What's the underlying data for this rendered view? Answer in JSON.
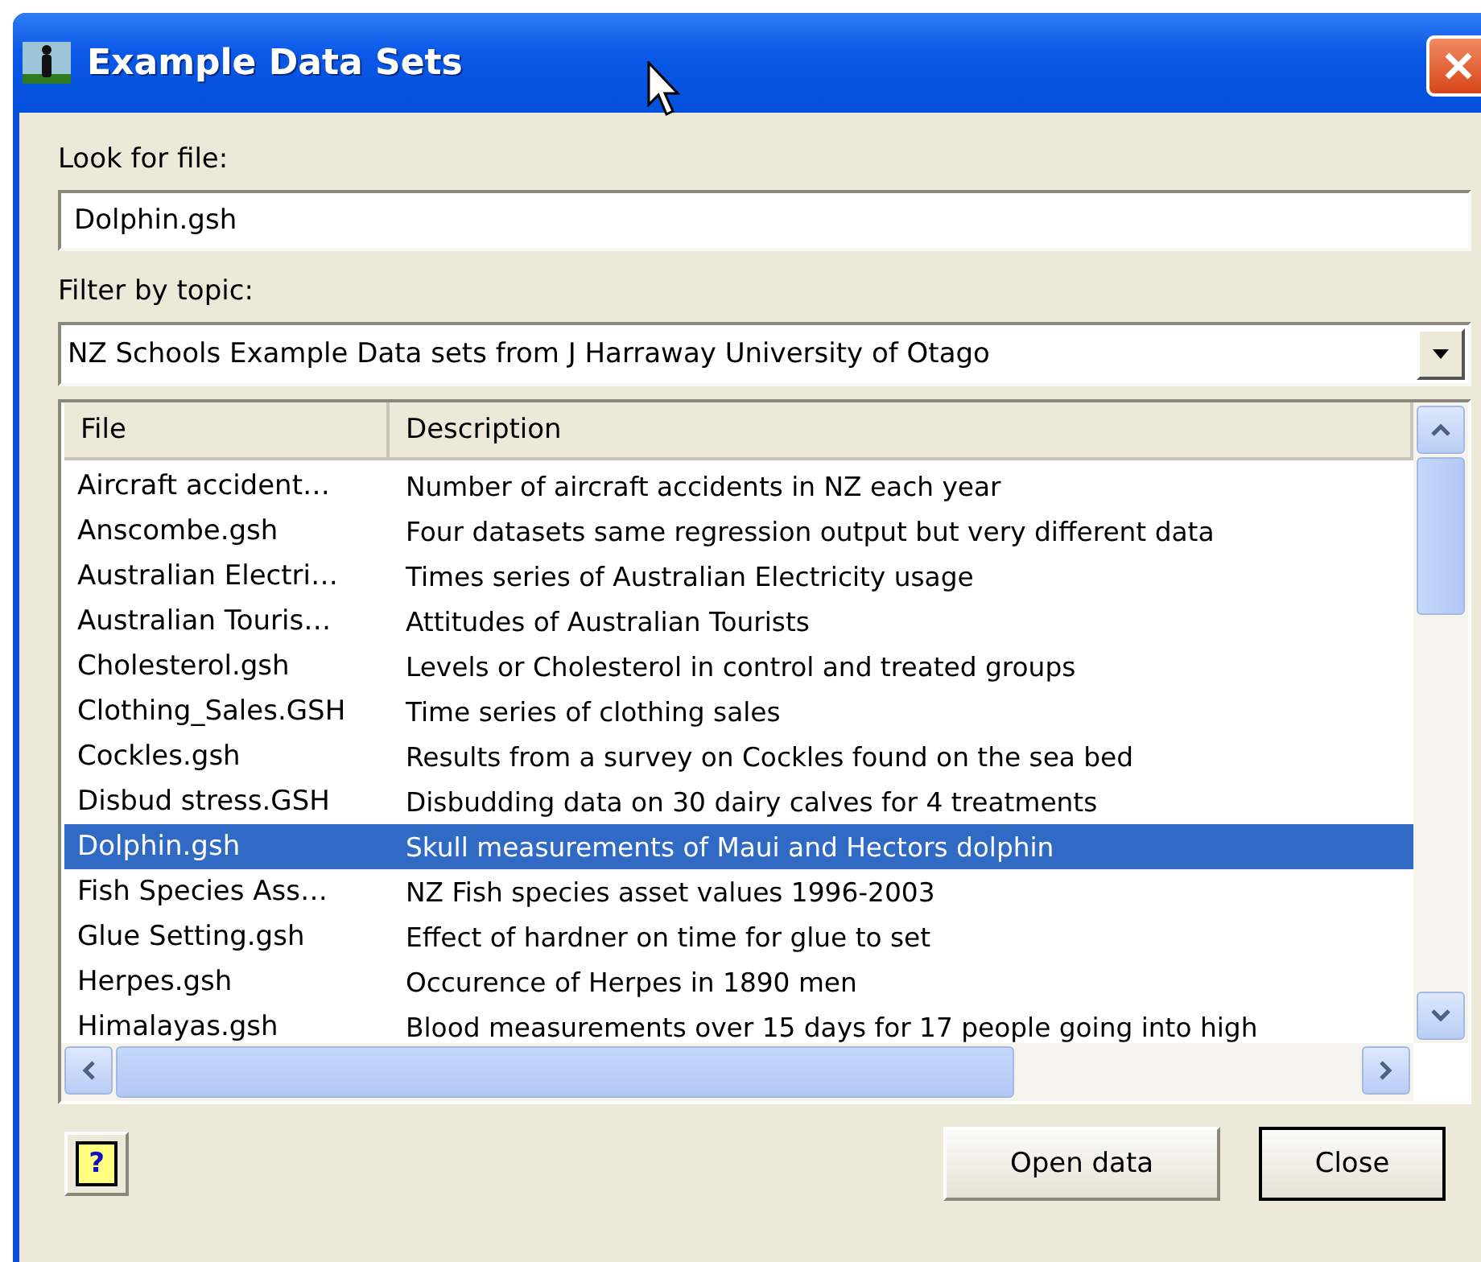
{
  "window": {
    "title": "Example Data Sets"
  },
  "look_for_file": {
    "label": "Look for file:",
    "value": "Dolphin.gsh"
  },
  "filter": {
    "label": "Filter by topic:",
    "value": "NZ Schools Example Data sets from J Harraway University of Otago"
  },
  "table": {
    "columns": [
      "File",
      "Description"
    ],
    "rows": [
      {
        "file": "Aircraft accident…",
        "description": "Number of aircraft accidents in NZ each year",
        "selected": false
      },
      {
        "file": "Anscombe.gsh",
        "description": "Four datasets same regression output but very different data",
        "selected": false
      },
      {
        "file": "Australian Electri…",
        "description": "Times series of Australian Electricity usage",
        "selected": false
      },
      {
        "file": "Australian Touris…",
        "description": "Attitudes of Australian Tourists",
        "selected": false
      },
      {
        "file": "Cholesterol.gsh",
        "description": "Levels or Cholesterol in control and treated groups",
        "selected": false
      },
      {
        "file": "Clothing_Sales.GSH",
        "description": "Time series of clothing sales",
        "selected": false
      },
      {
        "file": "Cockles.gsh",
        "description": "Results from a survey on Cockles found on the sea bed",
        "selected": false
      },
      {
        "file": "Disbud stress.GSH",
        "description": "Disbudding data on 30 dairy calves for 4 treatments",
        "selected": false
      },
      {
        "file": "Dolphin.gsh",
        "description": "Skull measurements of Maui and Hectors dolphin",
        "selected": true
      },
      {
        "file": "Fish Species Ass…",
        "description": "NZ Fish species asset values 1996-2003",
        "selected": false
      },
      {
        "file": "Glue Setting.gsh",
        "description": "Effect of hardner on time for glue to set",
        "selected": false
      },
      {
        "file": "Herpes.gsh",
        "description": "Occurence of Herpes in 1890 men",
        "selected": false
      },
      {
        "file": "Himalayas.gsh",
        "description": "Blood measurements over 15 days for 17 people going into high",
        "selected": false
      }
    ]
  },
  "help_button": "?",
  "buttons": [
    {
      "label": "Open data",
      "default": false
    },
    {
      "label": "Close",
      "default": true
    }
  ]
}
